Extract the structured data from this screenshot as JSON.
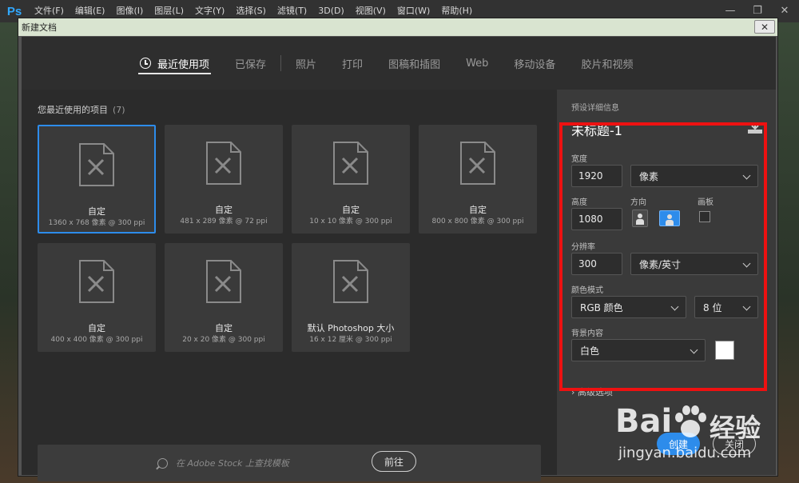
{
  "menubar": {
    "logo": "Ps",
    "items": [
      "文件(F)",
      "编辑(E)",
      "图像(I)",
      "图层(L)",
      "文字(Y)",
      "选择(S)",
      "滤镜(T)",
      "3D(D)",
      "视图(V)",
      "窗口(W)",
      "帮助(H)"
    ],
    "min": "—",
    "restore": "❐",
    "close": "✕"
  },
  "dialog": {
    "title": "新建文档",
    "close": "✕"
  },
  "tabs": [
    "最近使用项",
    "已保存",
    "照片",
    "打印",
    "图稿和插图",
    "Web",
    "移动设备",
    "胶片和视频"
  ],
  "recent": {
    "header": "您最近使用的项目",
    "count": "(7)",
    "items": [
      {
        "name": "自定",
        "desc": "1360 x 768 像素 @ 300 ppi"
      },
      {
        "name": "自定",
        "desc": "481 x 289 像素 @ 72 ppi"
      },
      {
        "name": "自定",
        "desc": "10 x 10 像素 @ 300 ppi"
      },
      {
        "name": "自定",
        "desc": "800 x 800 像素 @ 300 ppi"
      },
      {
        "name": "自定",
        "desc": "400 x 400 像素 @ 300 ppi"
      },
      {
        "name": "自定",
        "desc": "20 x 20 像素 @ 300 ppi"
      },
      {
        "name": "默认 Photoshop 大小",
        "desc": "16 x 12 厘米 @ 300 ppi"
      }
    ]
  },
  "stock": {
    "placeholder": "在 Adobe Stock 上查找模板",
    "go": "前往"
  },
  "preset": {
    "label": "预设详细信息",
    "title": "未标题-1",
    "width_label": "宽度",
    "width_value": "1920",
    "width_unit": "像素",
    "height_label": "高度",
    "height_value": "1080",
    "orientation_label": "方向",
    "artboard_label": "画板",
    "resolution_label": "分辨率",
    "resolution_value": "300",
    "resolution_unit": "像素/英寸",
    "color_mode_label": "颜色模式",
    "color_mode": "RGB 颜色",
    "bit_depth": "8 位",
    "background_label": "背景内容",
    "background": "白色",
    "background_color": "#ffffff",
    "advanced": "高级选项"
  },
  "buttons": {
    "create": "创建",
    "close": "关闭"
  },
  "watermark": {
    "brand": "Bai",
    "brand2": "经验",
    "url": "jingyan.baidu.com"
  },
  "colors": {
    "accent": "#2d8ceb",
    "highlight": "#ee1111"
  }
}
